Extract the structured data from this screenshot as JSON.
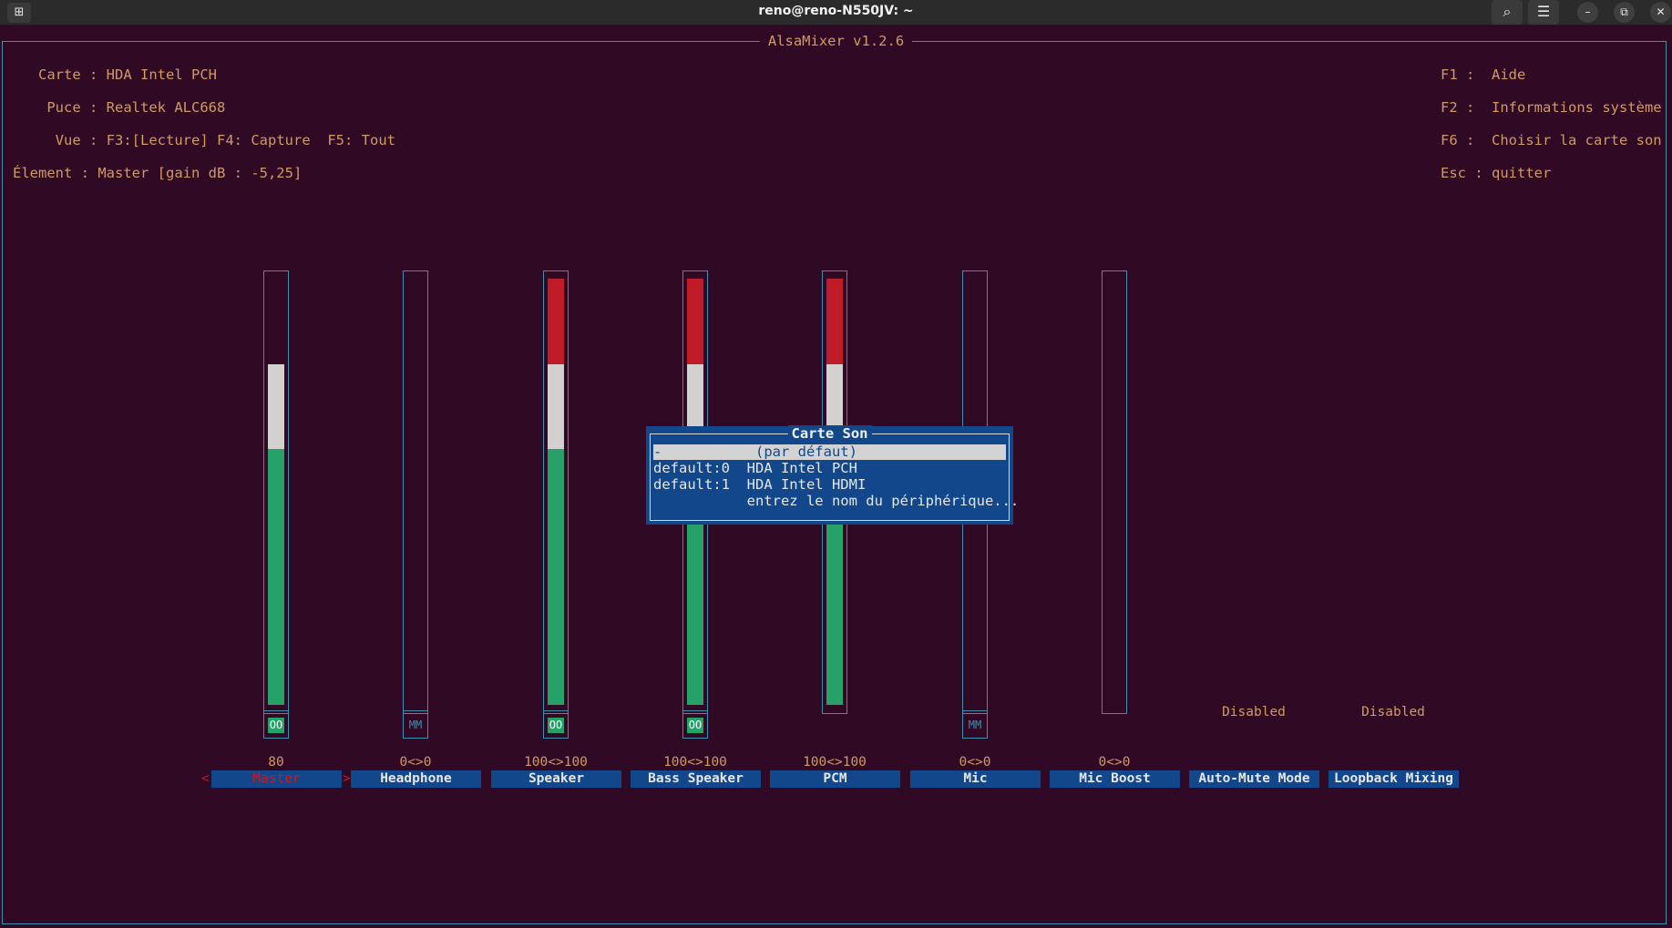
{
  "window": {
    "title": "reno@reno-N550JV: ~",
    "new_tab_icon": "new-tab-icon",
    "search_icon": "search-icon",
    "menu_icon": "hamburger-menu-icon",
    "min_glyph": "–",
    "max_glyph": "⧉",
    "close_glyph": "✕",
    "new_tab_glyph": "⊞",
    "search_glyph": "⌕",
    "menu_glyph": "☰"
  },
  "app": {
    "title": "AlsaMixer v1.2.6"
  },
  "info": {
    "card_label": "Carte :",
    "card_value": "HDA Intel PCH",
    "chip_label": "Puce :",
    "chip_value": "Realtek ALC668",
    "view_label": "Vue :",
    "view_f3": "F3:[Lecture]",
    "view_f4": "F4: Capture",
    "view_f5": "F5: Tout",
    "element_label": "Élement :",
    "element_value": "Master [gain dB : -5,25]"
  },
  "help": [
    {
      "key": "F1 :",
      "text": "Aide"
    },
    {
      "key": "F2 :",
      "text": "Informations système"
    },
    {
      "key": "F6 :",
      "text": "Choisir la carte son"
    },
    {
      "key": "Esc :",
      "text": "quitter"
    }
  ],
  "controls": [
    {
      "name": "Master",
      "volume": "80",
      "mute": "OO",
      "level": 0.8,
      "selected": true
    },
    {
      "name": "Headphone",
      "volume": "0<>0",
      "mute": "MM",
      "level": 0
    },
    {
      "name": "Speaker",
      "volume": "100<>100",
      "mute": "OO",
      "level": 1.0
    },
    {
      "name": "Bass Speaker",
      "volume": "100<>100",
      "mute": "OO",
      "level": 1.0
    },
    {
      "name": "PCM",
      "volume": "100<>100",
      "mute": "",
      "level": 1.0
    },
    {
      "name": "Mic",
      "volume": "0<>0",
      "mute": "MM",
      "level": 0
    },
    {
      "name": "Mic Boost",
      "volume": "0<>0",
      "mute": "",
      "level": 0
    },
    {
      "name": "Auto-Mute Mode",
      "value": "Disabled"
    },
    {
      "name": "Loopback Mixing",
      "value": "Disabled"
    }
  ],
  "selection_arrows": {
    "left": "<",
    "right": ">"
  },
  "dialog": {
    "title": "Carte Son",
    "items": [
      {
        "text": "-           (par défaut)",
        "selected": true
      },
      {
        "text": "default:0  HDA Intel PCH"
      },
      {
        "text": "default:1  HDA Intel HDMI"
      },
      {
        "text": "           entrez le nom du périphérique..."
      }
    ]
  },
  "colors": {
    "background": "#300a24",
    "accent_orange": "#d09a63",
    "border_blue": "#3f8fb0",
    "bar_blue": "#12488b",
    "level_green": "#26a269",
    "level_white": "#d3d0d0",
    "level_red": "#c01c28"
  }
}
